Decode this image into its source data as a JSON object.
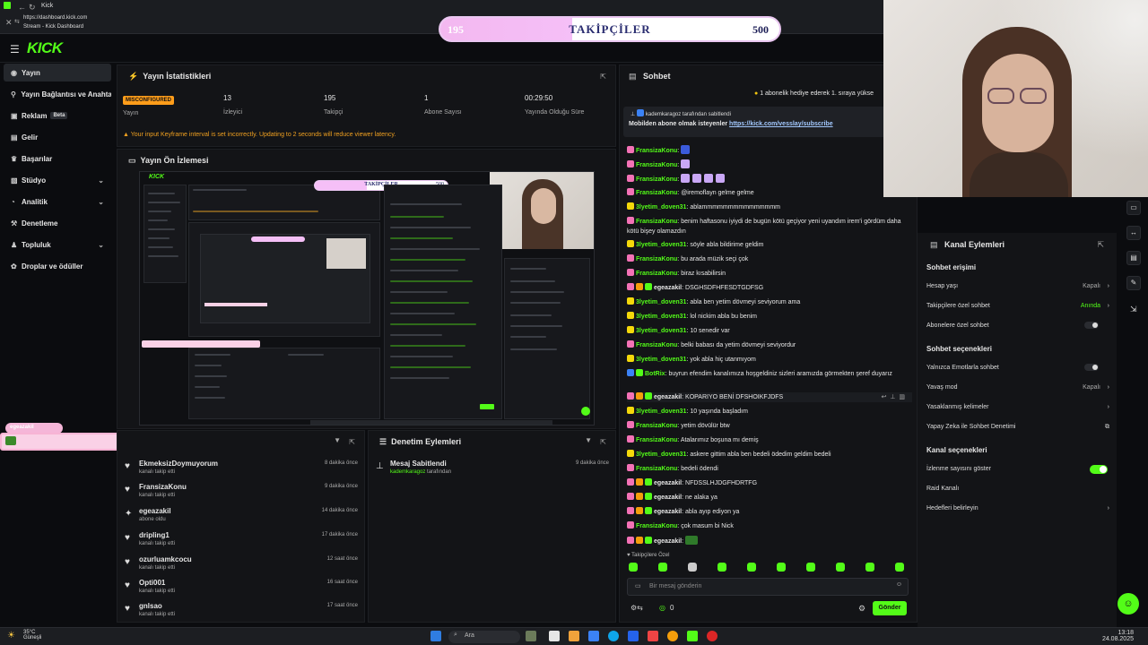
{
  "browser": {
    "tab_title": "Kick",
    "url": "https://dashboard.kick.com",
    "page_title": "Stream - Kick Dashboard"
  },
  "follower_goal": {
    "current": "195",
    "label": "TAKİPÇİLER",
    "target": "500",
    "progress": 0.39
  },
  "brand": {
    "logo": "KICK",
    "accent": "#53fc18"
  },
  "sidebar": {
    "items": [
      {
        "label": "Yayın",
        "icon": "broadcast-icon",
        "active": true
      },
      {
        "label": "Yayın Bağlantısı ve Anahtarı",
        "icon": "link-icon"
      },
      {
        "label": "Reklam",
        "icon": "ad-icon",
        "badge": "Beta"
      },
      {
        "label": "Gelir",
        "icon": "money-icon"
      },
      {
        "label": "Başarılar",
        "icon": "trophy-icon"
      },
      {
        "label": "Stüdyo",
        "icon": "studio-icon",
        "chevron": true
      },
      {
        "label": "Analitik",
        "icon": "chart-icon",
        "chevron": true
      },
      {
        "label": "Denetleme",
        "icon": "hammer-icon"
      },
      {
        "label": "Topluluk",
        "icon": "community-icon",
        "chevron": true
      },
      {
        "label": "Droplar ve ödüller",
        "icon": "gift-icon"
      }
    ]
  },
  "stats": {
    "title": "Yayın İstatistikleri",
    "status_badge": "MISCONFIGURED",
    "items": [
      {
        "value": "",
        "label": "Yayın"
      },
      {
        "value": "13",
        "label": "İzleyici"
      },
      {
        "value": "195",
        "label": "Takipçi"
      },
      {
        "value": "1",
        "label": "Abone Sayısı"
      },
      {
        "value": "00:29:50",
        "label": "Yayında Olduğu Süre"
      }
    ],
    "warning": "Your input Keyframe interval is set incorrectly. Updating to 2 seconds will reduce viewer latency."
  },
  "preview": {
    "title": "Yayın Ön İzlemesi",
    "mini_label": "TAKİPÇİLER",
    "mini_target": "500"
  },
  "overlay_chip": "egeazakil",
  "activity": {
    "rows": [
      {
        "name": "EkmeksizDoymuyorum",
        "sub": "kanalı takip etti",
        "time": "8 dakika önce",
        "icon": "heart-icon"
      },
      {
        "name": "FransizaKonu",
        "sub": "kanalı takip etti",
        "time": "9 dakika önce",
        "icon": "heart-icon"
      },
      {
        "name": "egeazakil",
        "sub": "abone oldu",
        "time": "14 dakika önce",
        "icon": "star-icon"
      },
      {
        "name": "dripling1",
        "sub": "kanalı takip etti",
        "time": "17 dakika önce",
        "icon": "heart-icon"
      },
      {
        "name": "ozurluamkcocu",
        "sub": "kanalı takip etti",
        "time": "12 saat önce",
        "icon": "heart-icon"
      },
      {
        "name": "Opti001",
        "sub": "kanalı takip etti",
        "time": "16 saat önce",
        "icon": "heart-icon"
      },
      {
        "name": "gnlsao",
        "sub": "kanalı takip etti",
        "time": "17 saat önce",
        "icon": "heart-icon"
      }
    ]
  },
  "moderation": {
    "title": "Denetim Eylemleri",
    "rows": [
      {
        "title": "Mesaj Sabitlendi",
        "by": "kademkaragoz",
        "by_suffix": "tarafından",
        "time": "9 dakika önce"
      }
    ]
  },
  "chat": {
    "title": "Sohbet",
    "gift_banner": "1 abonelik hediye ederek 1. sıraya yükse",
    "pinned_by": "kademkaragoz tarafından sabitlendi",
    "pinned_text": "Mobilden abone olmak isteyenler",
    "pinned_link": "https://kick.com/vesslay/subscribe",
    "messages": [
      {
        "user": "FransizaKonu",
        "color": "#53fc18",
        "text": ""
      },
      {
        "user": "FransizaKonu",
        "color": "#53fc18",
        "text": ""
      },
      {
        "user": "FransizaKonu",
        "color": "#53fc18",
        "text": ""
      },
      {
        "user": "FransizaKonu",
        "color": "#53fc18",
        "text": "@iremoflayn gelme gelme"
      },
      {
        "user": "3lyetim_doven31",
        "color": "#53fc18",
        "text": "ablammmmmmmmmmmmmmm"
      },
      {
        "user": "FransizaKonu",
        "color": "#53fc18",
        "text": "benim haftasonu iyiydi de bugün kötü geçiyor yeni uyandım irem'i gördüm daha kötü bişey olamazdın"
      },
      {
        "user": "3lyetim_doven31",
        "color": "#53fc18",
        "text": "söyle abla bildirime geldim"
      },
      {
        "user": "FransizaKonu",
        "color": "#53fc18",
        "text": "bu arada müzik seçi çok"
      },
      {
        "user": "FransizaKonu",
        "color": "#53fc18",
        "text": "biraz kısabilirsin"
      },
      {
        "user": "egeazakil",
        "color": "#e6e6e6",
        "text": "DSGHSDFHFESDTGDFSG"
      },
      {
        "user": "3lyetim_doven31",
        "color": "#53fc18",
        "text": "abla ben yetim dövmeyi seviyorum ama"
      },
      {
        "user": "3lyetim_doven31",
        "color": "#53fc18",
        "text": "lol nickim abla bu benim"
      },
      {
        "user": "3lyetim_doven31",
        "color": "#53fc18",
        "text": "10 senedir var"
      },
      {
        "user": "FransizaKonu",
        "color": "#53fc18",
        "text": "belki babası da yetim dövmeyi seviyordur"
      },
      {
        "user": "3lyetim_doven31",
        "color": "#53fc18",
        "text": "yok abla hiç utanmıyom"
      },
      {
        "user": "BotRix",
        "color": "#53fc18",
        "text": "buyrun efendim kanalımıza hoşgeldiniz sizleri aramızda görmekten şeref duyarız"
      },
      {
        "user": "egeazakil",
        "color": "#e6e6e6",
        "text": "KOPARIYO BENİ DFSHOIKFJDFS"
      },
      {
        "user": "3lyetim_doven31",
        "color": "#53fc18",
        "text": "10 yaşında başladım"
      },
      {
        "user": "FransizaKonu",
        "color": "#53fc18",
        "text": "yetim dövülür btw"
      },
      {
        "user": "FransizaKonu",
        "color": "#53fc18",
        "text": "Atalarımız boşuna mı demiş"
      },
      {
        "user": "3lyetim_doven31",
        "color": "#53fc18",
        "text": "askere gittim abla ben bedeli ödedim geldim bedeli"
      },
      {
        "user": "FransizaKonu",
        "color": "#53fc18",
        "text": "bedeli ödendi"
      },
      {
        "user": "egeazakil",
        "color": "#e6e6e6",
        "text": "NFDSSLHJDGFHDRTFG"
      },
      {
        "user": "egeazakil",
        "color": "#e6e6e6",
        "text": "ne alaka ya"
      },
      {
        "user": "egeazakil",
        "color": "#e6e6e6",
        "text": "abla ayıp ediyon ya"
      },
      {
        "user": "FransizaKonu",
        "color": "#53fc18",
        "text": "çok masum bi Nick"
      },
      {
        "user": "egeazakil",
        "color": "#e6e6e6",
        "text": ""
      }
    ],
    "followers_only_label": "Takipçilere Özel",
    "input_placeholder": "Bir mesaj gönderin",
    "points": "0",
    "send_label": "Gönder"
  },
  "channel_actions": {
    "title": "Kanal Eylemleri",
    "sections": [
      {
        "heading": "Sohbet erişimi",
        "rows": [
          {
            "label": "Hesap yaşı",
            "value": "Kapalı",
            "control": "arrow"
          },
          {
            "label": "Takipçilere özel sohbet",
            "value": "Anında",
            "control": "arrow",
            "green": true
          },
          {
            "label": "Abonelere özel sohbet",
            "control": "toggle",
            "on": false
          }
        ]
      },
      {
        "heading": "Sohbet seçenekleri",
        "rows": [
          {
            "label": "Yalnızca Emotlarla sohbet",
            "control": "toggle",
            "on": false
          },
          {
            "label": "Yavaş mod",
            "value": "Kapalı",
            "control": "arrow"
          },
          {
            "label": "Yasaklanmış kelimeler",
            "control": "arrow"
          },
          {
            "label": "Yapay Zeka ile Sohbet Denetimi",
            "control": "external"
          }
        ]
      },
      {
        "heading": "Kanal seçenekleri",
        "rows": [
          {
            "label": "İzlenme sayısını göster",
            "control": "toggle",
            "on": true
          },
          {
            "label": "Raid Kanalı",
            "control": "none"
          },
          {
            "label": "Hedefleri belirleyin",
            "control": "arrow"
          }
        ]
      }
    ]
  },
  "taskbar": {
    "weather_temp": "35°C",
    "weather_desc": "Güneşli",
    "search_placeholder": "Ara",
    "time": "13:18",
    "date": "24.08.2025"
  }
}
